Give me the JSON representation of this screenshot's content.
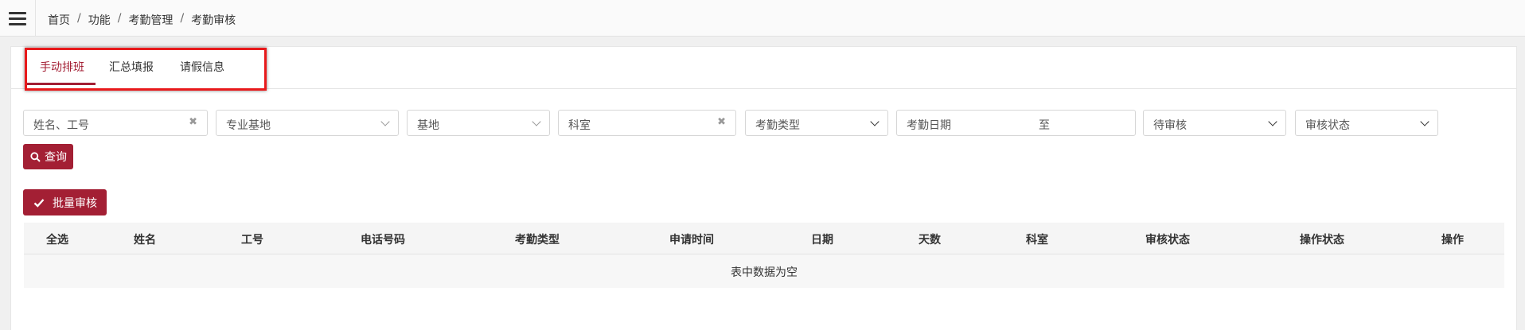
{
  "breadcrumb": [
    "首页",
    "功能",
    "考勤管理",
    "考勤审核"
  ],
  "tabs": [
    {
      "label": "手动排班",
      "active": true
    },
    {
      "label": "汇总填报",
      "active": false
    },
    {
      "label": "请假信息",
      "active": false
    }
  ],
  "filters": {
    "name_id_placeholder": "姓名、工号",
    "specialty_base": "专业基地",
    "base": "基地",
    "department": "科室",
    "attendance_type": "考勤类型",
    "attendance_date": "考勤日期",
    "date_to": "至",
    "review_filter": "待审核",
    "review_status": "审核状态"
  },
  "buttons": {
    "query": "查询",
    "batch_review": "批量审核"
  },
  "table": {
    "columns": [
      "全选",
      "姓名",
      "工号",
      "电话号码",
      "考勤类型",
      "申请时间",
      "日期",
      "天数",
      "科室",
      "审核状态",
      "操作状态",
      "操作"
    ],
    "empty_text": "表中数据为空"
  },
  "colors": {
    "accent": "#a31f34",
    "highlight": "#e8191b"
  }
}
